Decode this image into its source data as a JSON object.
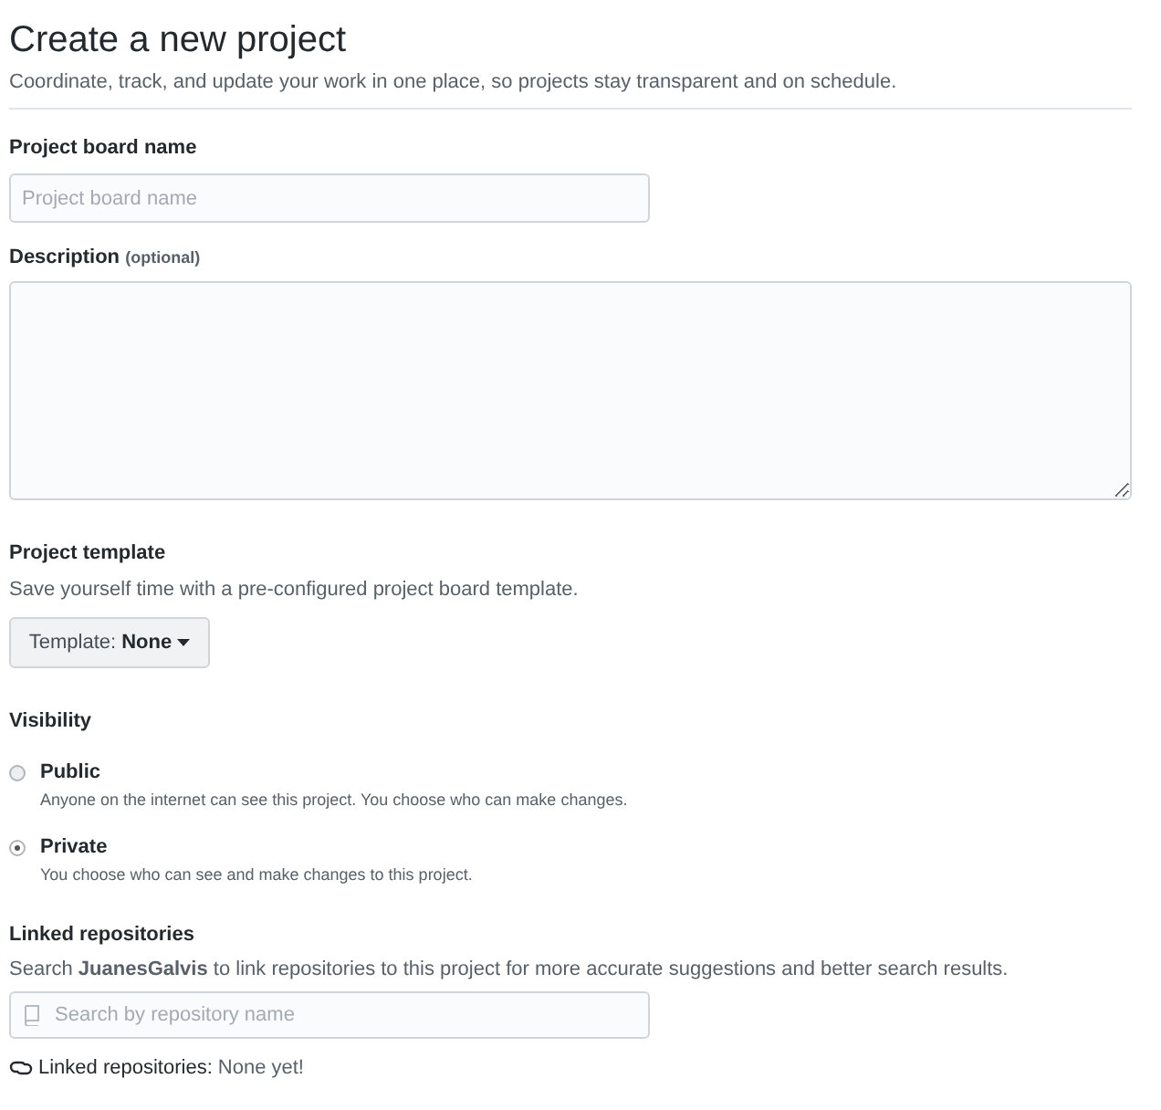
{
  "header": {
    "title": "Create a new project",
    "subtitle": "Coordinate, track, and update your work in one place, so projects stay transparent and on schedule."
  },
  "name_field": {
    "label": "Project board name",
    "placeholder": "Project board name"
  },
  "description_field": {
    "label": "Description",
    "note": "(optional)"
  },
  "template": {
    "label": "Project template",
    "hint": "Save yourself time with a pre-configured project board template.",
    "button_label": "Template:",
    "button_value": "None"
  },
  "visibility": {
    "label": "Visibility",
    "options": [
      {
        "label": "Public",
        "hint": "Anyone on the internet can see this project. You choose who can make changes.",
        "selected": false
      },
      {
        "label": "Private",
        "hint": "You choose who can see and make changes to this project.",
        "selected": true
      }
    ]
  },
  "linked_repositories": {
    "label": "Linked repositories",
    "hint": "Search **JuanesGalvis** to link repositories to this project for more accurate suggestions and better search results.",
    "search_placeholder": "Search by repository name",
    "status_label": "Linked repositories:",
    "status_value": "None yet!"
  }
}
